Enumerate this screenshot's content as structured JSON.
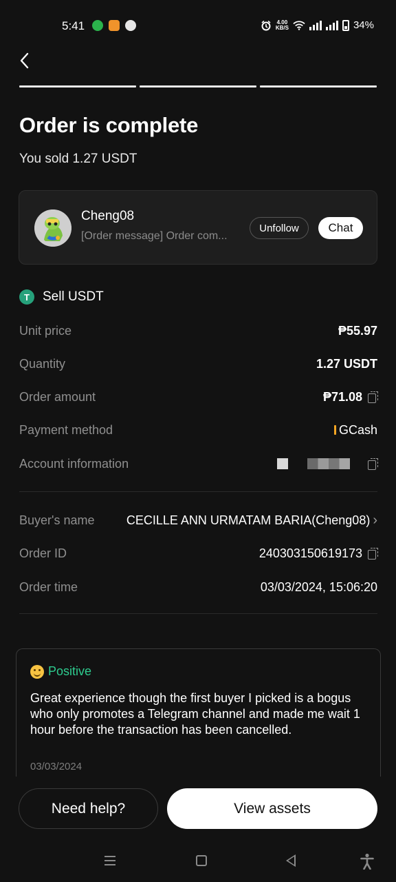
{
  "status_bar": {
    "time": "5:41",
    "net_speed_value": "4.00",
    "net_speed_unit": "KB/S",
    "battery": "34%",
    "icons": [
      "alarm-icon",
      "wifi-icon",
      "signal-icon",
      "signal-icon",
      "battery-icon"
    ]
  },
  "header": {
    "back_icon": "chevron-left-icon",
    "progress_steps": 3,
    "progress_completed": 3
  },
  "title": "Order is complete",
  "subtitle": "You sold 1.27 USDT",
  "counterparty": {
    "name": "Cheng08",
    "last_message": "[Order message] Order com...",
    "unfollow_label": "Unfollow",
    "chat_label": "Chat"
  },
  "order": {
    "side_label": "Sell USDT",
    "coin_icon": "tether-icon",
    "rows": [
      {
        "label": "Unit price",
        "value": "₱55.97"
      },
      {
        "label": "Quantity",
        "value": "1.27 USDT"
      },
      {
        "label": "Order amount",
        "value": "₱71.08"
      },
      {
        "label": "Payment method",
        "value": "GCash"
      },
      {
        "label": "Account information",
        "value": ""
      }
    ],
    "buyer_label": "Buyer's name",
    "buyer_value": "CECILLE ANN URMATAM BARIA(Cheng08)",
    "order_id_label": "Order ID",
    "order_id_value": "240303150619173",
    "order_time_label": "Order time",
    "order_time_value": "03/03/2024, 15:06:20"
  },
  "review": {
    "rating": "Positive",
    "text": "Great experience though the first buyer I picked is a bogus who only promotes a Telegram channel and made me wait 1 hour before the transaction has been cancelled.",
    "date": "03/03/2024"
  },
  "actions": {
    "help_label": "Need help?",
    "assets_label": "View assets"
  },
  "colors": {
    "background": "#121212",
    "card": "#1e1e1e",
    "positive": "#2ecc8f",
    "tether": "#26a17b",
    "gcash_marker": "#f5a623"
  }
}
